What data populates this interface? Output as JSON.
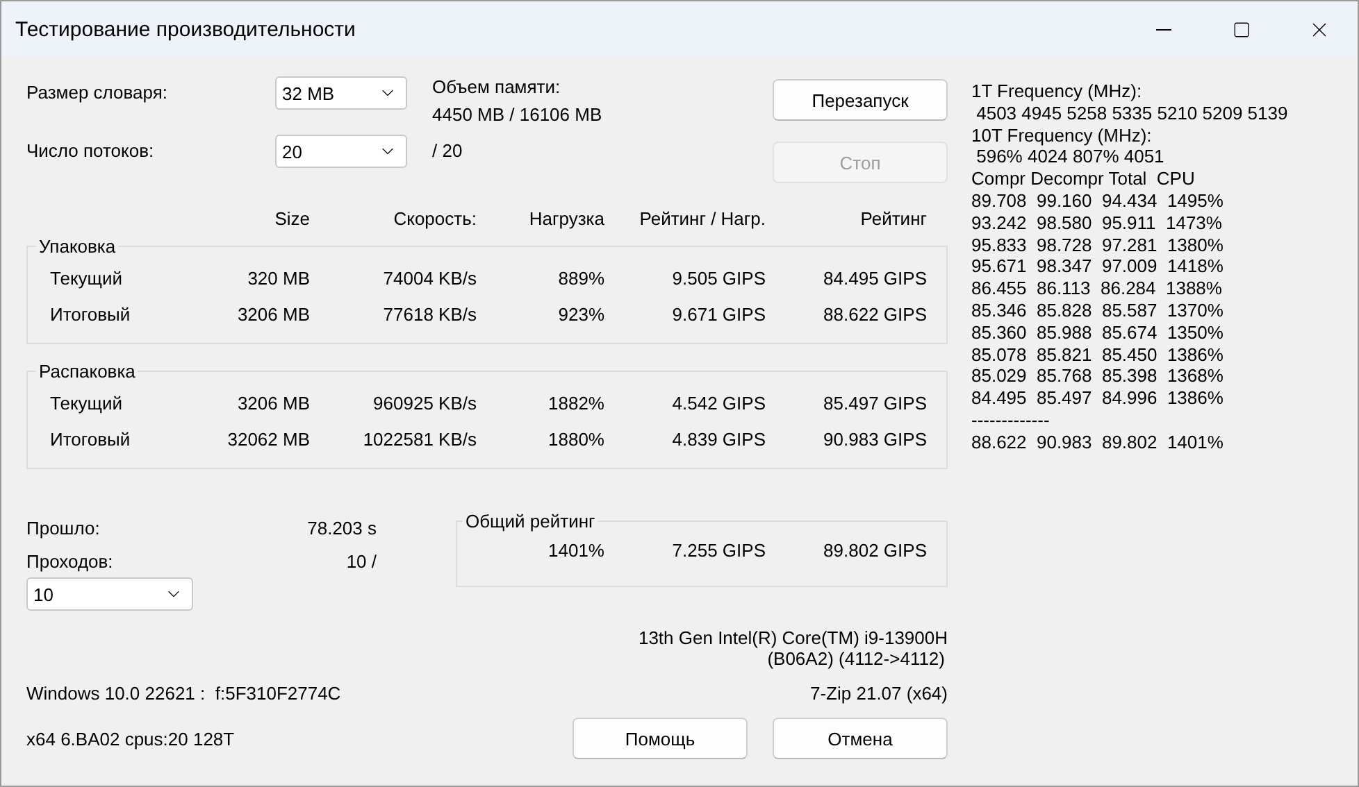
{
  "window": {
    "title": "Тестирование производительности"
  },
  "settings": [
    {
      "label": "Размер словаря:",
      "value": "32 MB"
    },
    {
      "label": "Число потоков:",
      "value": "20"
    }
  ],
  "memory": {
    "label": "Объем памяти:",
    "value": "4450 MB / 16106 MB"
  },
  "threads_max": "/ 20",
  "buttons_top": [
    {
      "label": "Перезапуск",
      "disabled": false
    },
    {
      "label": "Стоп",
      "disabled": true
    }
  ],
  "columns": [
    "Size",
    "Скорость:",
    "Нагрузка",
    "Рейтинг / Нагр.",
    "Рейтинг"
  ],
  "groups": [
    {
      "title": "Упаковка",
      "rows": [
        {
          "label": "Текущий",
          "cells": [
            "320 MB",
            "74004 KB/s",
            "889%",
            "9.505 GIPS",
            "84.495 GIPS"
          ]
        },
        {
          "label": "Итоговый",
          "cells": [
            "3206 MB",
            "77618 KB/s",
            "923%",
            "9.671 GIPS",
            "88.622 GIPS"
          ]
        }
      ]
    },
    {
      "title": "Распаковка",
      "rows": [
        {
          "label": "Текущий",
          "cells": [
            "3206 MB",
            "960925 KB/s",
            "1882%",
            "4.542 GIPS",
            "85.497 GIPS"
          ]
        },
        {
          "label": "Итоговый",
          "cells": [
            "32062 MB",
            "1022581 KB/s",
            "1880%",
            "4.839 GIPS",
            "90.983 GIPS"
          ]
        }
      ]
    }
  ],
  "elapsed": {
    "label": "Прошло:",
    "value": "78.203 s"
  },
  "passes": {
    "label": "Проходов:",
    "value": "10 /",
    "select": "10"
  },
  "overall": {
    "title": "Общий рейтинг",
    "values": [
      "1401%",
      "7.255 GIPS",
      "89.802 GIPS"
    ]
  },
  "cpu": [
    "13th Gen Intel(R) Core(TM) i9-13900H",
    "(B06A2) (4112->4112)"
  ],
  "os": "Windows 10.0 22621 :  f:5F310F2774C",
  "version": "7-Zip 21.07 (x64)",
  "arch": "x64 6.BA02 cpus:20 128T",
  "buttons_bottom": [
    "Помощь",
    "Отмена"
  ],
  "log": [
    "1T Frequency (MHz):",
    " 4503 4945 5258 5335 5210 5209 5139",
    "10T Frequency (MHz):",
    " 596% 4024 807% 4051",
    "Compr Decompr Total  CPU",
    "89.708  99.160  94.434  1495%",
    "93.242  98.580  95.911  1473%",
    "95.833  98.728  97.281  1380%",
    "95.671  98.347  97.009  1418%",
    "86.455  86.113  86.284  1388%",
    "85.346  85.828  85.587  1370%",
    "85.360  85.988  85.674  1350%",
    "85.078  85.821  85.450  1386%",
    "85.029  85.768  85.398  1368%",
    "84.495  85.497  84.996  1386%",
    "-------------",
    "88.622  90.983  89.802  1401%"
  ]
}
